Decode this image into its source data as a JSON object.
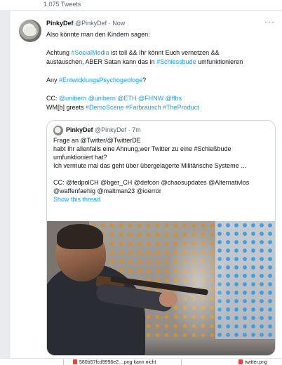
{
  "top": {
    "tweet_count": "1,075 Tweets"
  },
  "tweet": {
    "author_name": "PinkyDef",
    "author_handle": "@PinkyDef",
    "time": "· Now",
    "more_icon": "more-dots-icon",
    "lines": {
      "l1": "Also könnte man den Kindern sagen:",
      "l2a": "Achtung ",
      "l2b": "#SocialMedia",
      "l2c": " ist toll && Ihr könnt Euch vernetzen &&",
      "l3a": "austauschen, ABER Satan kann das in ",
      "l3b": "#Schiessbude",
      "l3c": " umfunktionieren",
      "l4a": "Any ",
      "l4b": "#EntwicklungsPsychogeologe",
      "l4c": "?",
      "l5a": "CC: ",
      "l5b": "@unibern @unibern @ETH @FHNW @ffhs",
      "l6a": "WM[b] greets ",
      "l6b": "#DemoScene #Farbrausch #TheProduct"
    }
  },
  "quote": {
    "author_name": "PinkyDef",
    "author_handle": "@PinkyDef",
    "time": "· 7m",
    "lines": {
      "q1": "Frage an @Twitter/@TwitterDE",
      "q2": "habt Ihr allenfalls eine Ahnung,wer Twitter zu eine #Schießbude",
      "q3": "umfunktioniert hat?",
      "q4": "Ich vermute mal das geht über übergelagerte Militärische Systeme …",
      "q5": "CC: @fedpolCH @bger_CH @defcon @chaosupdates @Alternativlos",
      "q6": "@waffenfaehig @maltman23 @ioerror",
      "show_thread": "Show this thread"
    }
  },
  "downloads": {
    "item1": "580b57fcd9996e2....png kann nicht",
    "item2": "twitter.png"
  },
  "colors": {
    "link": "#1d9bf0",
    "text": "#0f1419",
    "muted": "#536471"
  }
}
